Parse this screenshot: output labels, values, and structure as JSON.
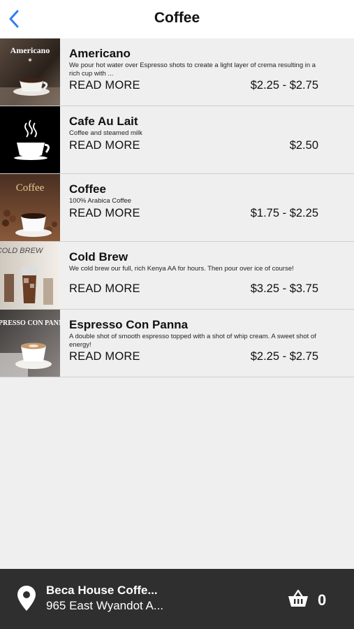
{
  "header": {
    "title": "Coffee",
    "back_icon": "chevron-left-icon",
    "accent_color": "#2f7cf6"
  },
  "menu_items": [
    {
      "name": "Americano",
      "description": "We pour hot water over Espresso shots to create a light layer of crema resulting in a rich cup with ...",
      "read_more": "READ MORE",
      "price": "$2.25 - $2.75",
      "image_text": "Americano"
    },
    {
      "name": "Cafe Au Lait",
      "description": "Coffee and steamed milk",
      "read_more": "READ MORE",
      "price": "$2.50",
      "image_text": ""
    },
    {
      "name": "Coffee",
      "description": "100% Arabica Coffee",
      "read_more": "READ MORE",
      "price": "$1.75 - $2.25",
      "image_text": "Coffee"
    },
    {
      "name": "Cold Brew",
      "description": "We cold brew our full, rich Kenya AA  for hours. Then pour over ice of course!",
      "read_more": "READ MORE",
      "price": "$3.25 - $3.75",
      "image_text": "COLD BREW"
    },
    {
      "name": "Espresso Con Panna",
      "description": "A double shot of smooth espresso topped with a shot of whip cream.  A sweet shot of energy!",
      "read_more": "READ MORE",
      "price": "$2.25 - $2.75",
      "image_text": "ESPRESSO CON PANNA"
    }
  ],
  "footer": {
    "store_name": "Beca House Coffe...",
    "store_address": "965 East Wyandot A...",
    "location_icon": "map-pin-icon",
    "cart_icon": "basket-icon",
    "cart_count": "0"
  }
}
